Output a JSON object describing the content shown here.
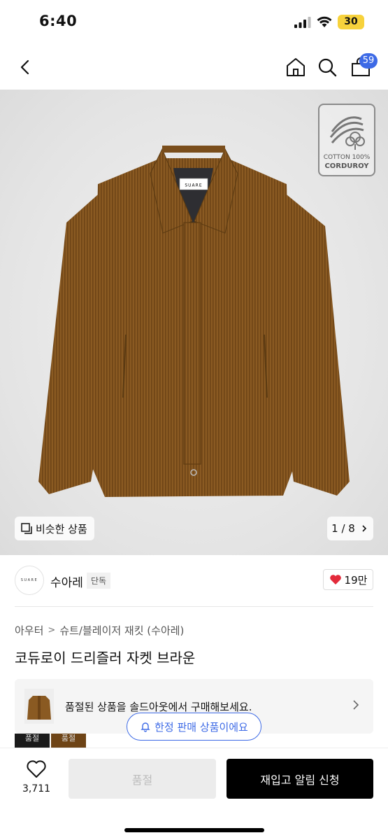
{
  "status_bar": {
    "time": "6:40",
    "battery": "30"
  },
  "nav": {
    "cart_count": "59"
  },
  "image": {
    "badge_line1": "COTTON 100%",
    "badge_line2": "CORDUROY",
    "label_text": "SUARE",
    "similar_label": "비슷한 상품",
    "page_counter": "1 / 8",
    "colors": {
      "jacket": "#8a5a22",
      "background": "#e6e6e6"
    }
  },
  "brand": {
    "logo_text": "SUARE",
    "name": "수아레",
    "badge": "단독",
    "like_label": "19만"
  },
  "breadcrumb": {
    "category": "아우터",
    "subcategory": "슈트/블레이저 재킷 (수아레)"
  },
  "product": {
    "title": "코듀로이 드리즐러 자켓 브라운"
  },
  "soldout_banner": {
    "text": "품절된 상품을 솔드아웃에서 구매해보세요."
  },
  "thumbs": [
    "품절",
    "품절"
  ],
  "restock_notice": {
    "text": "한정 판매 상품이에요"
  },
  "bottom_bar": {
    "like_count": "3,711",
    "soldout_label": "품절",
    "restock_label": "재입고 알림 신청"
  },
  "accent_color": "#3d6ae6",
  "like_color": "#e32a3a"
}
